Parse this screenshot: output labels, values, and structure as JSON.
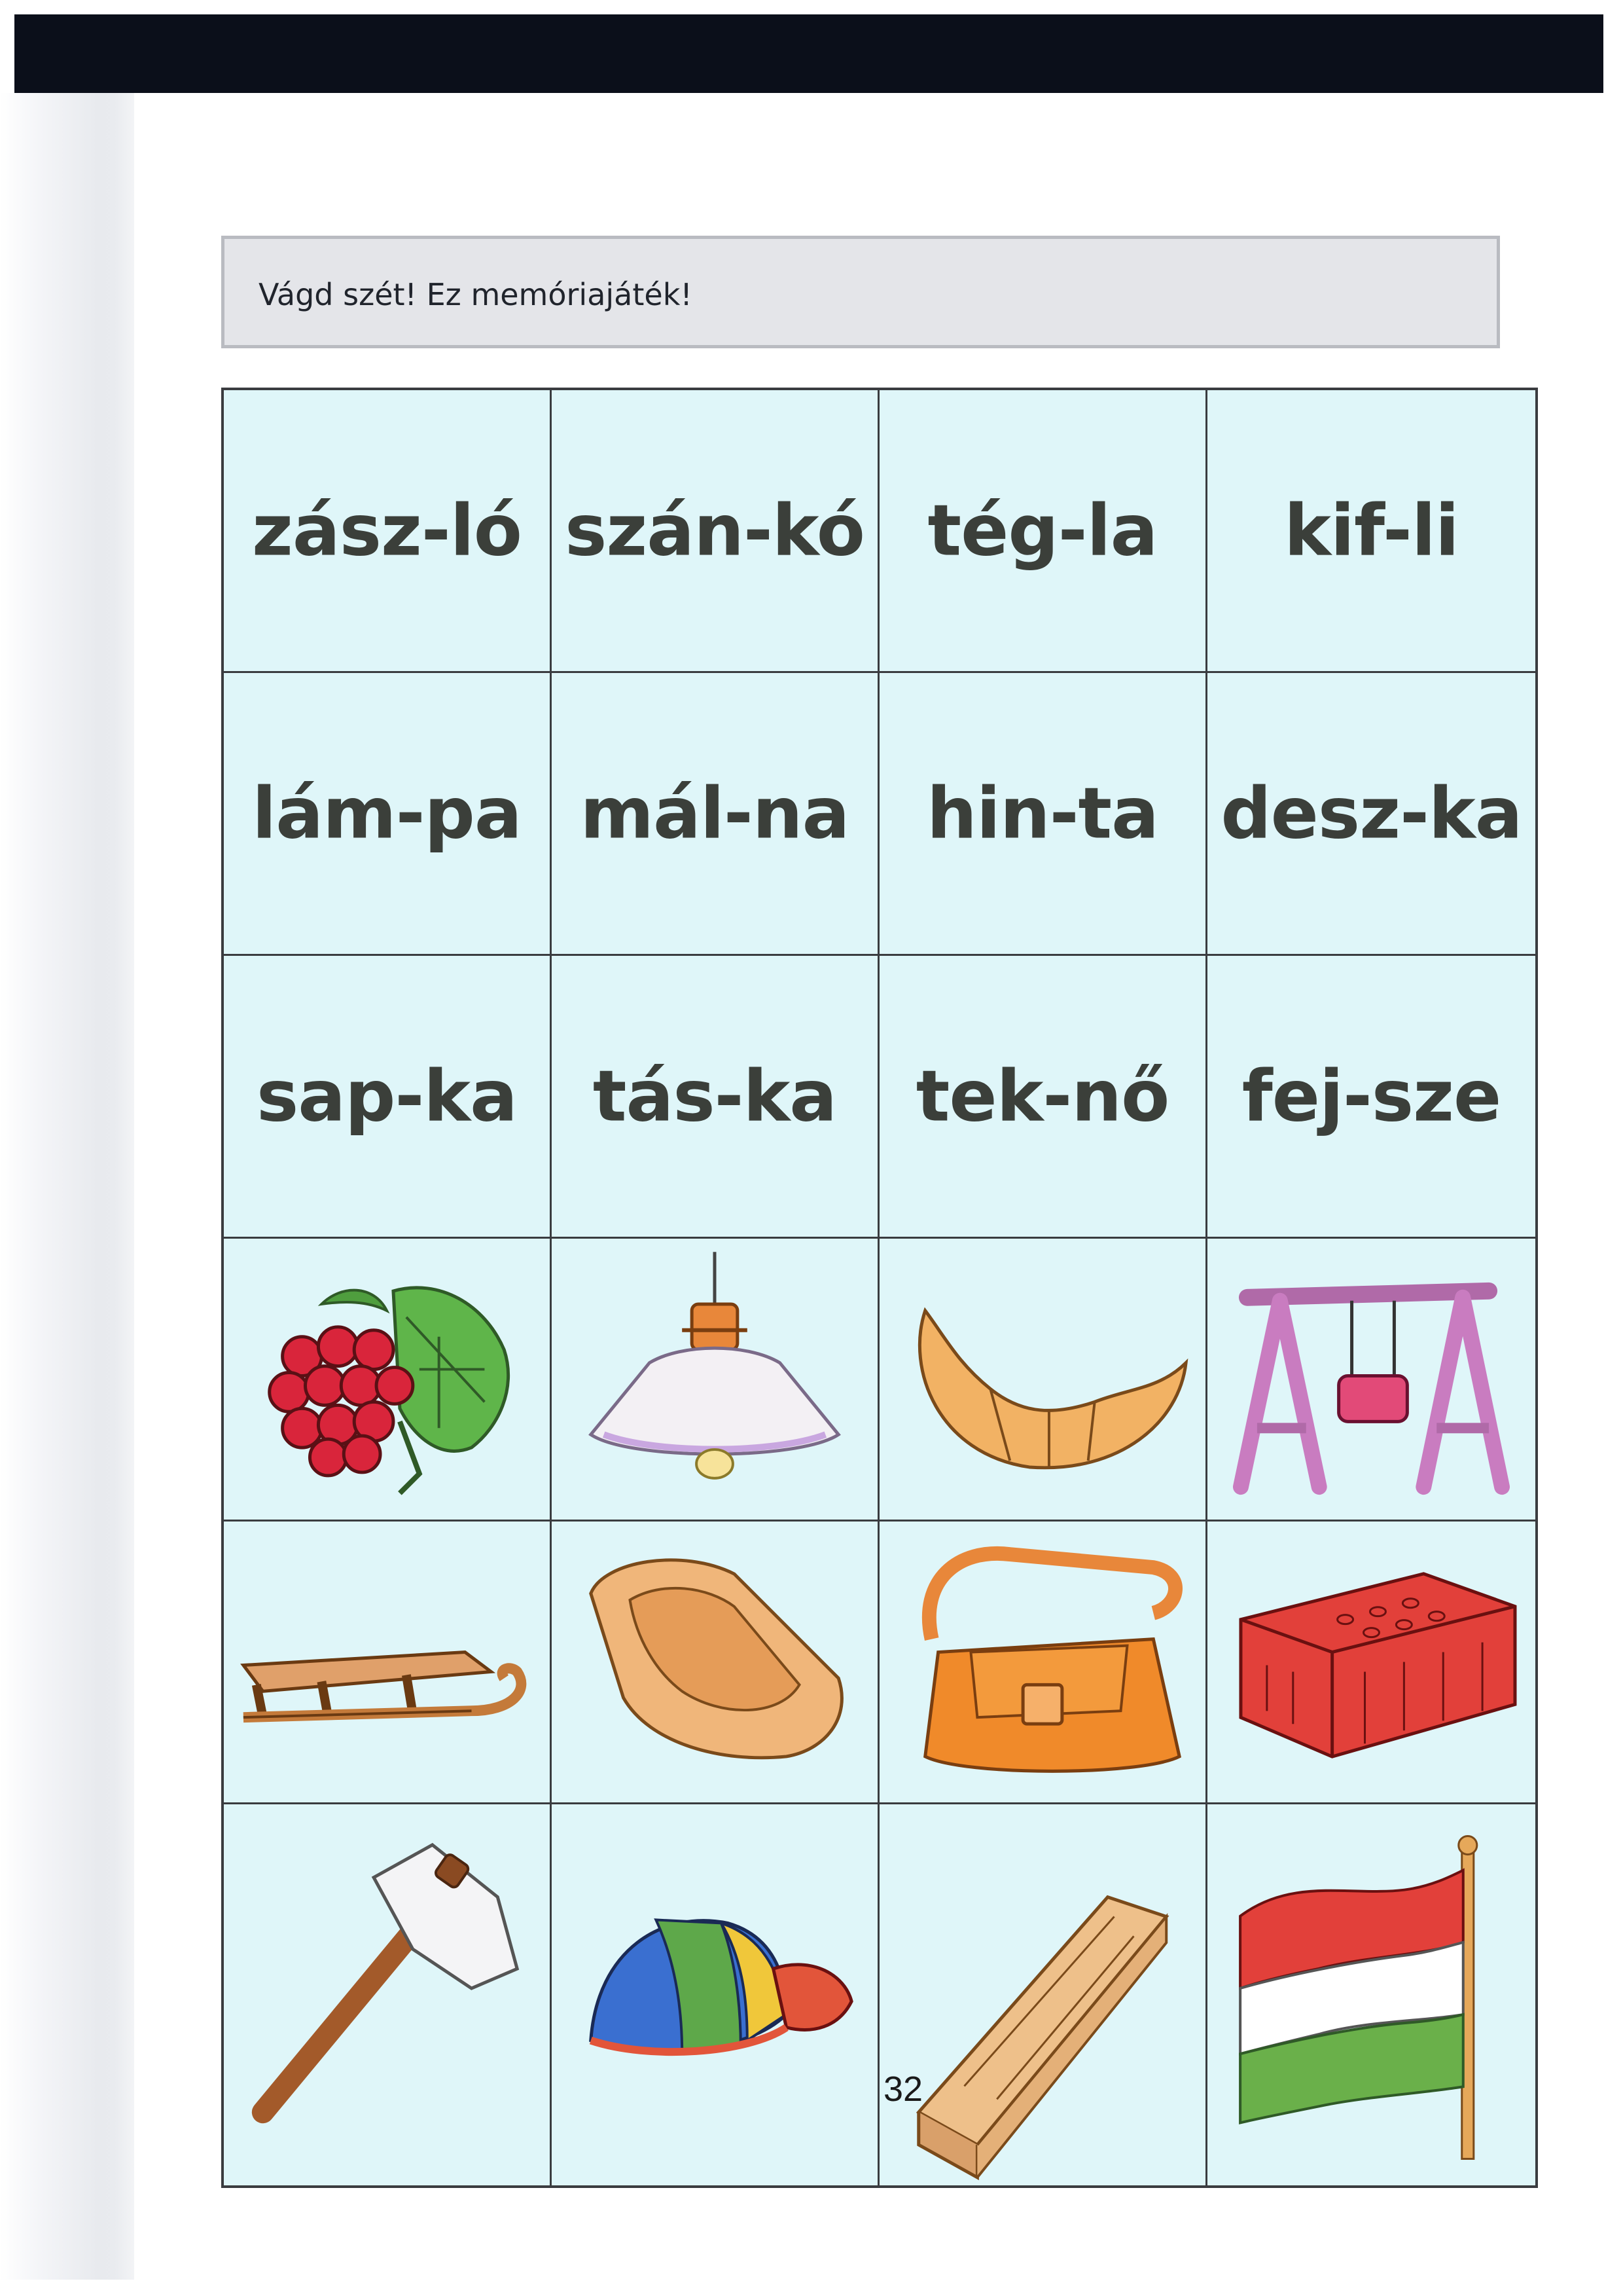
{
  "instruction": "Vágd szét! Ez memóriajáték!",
  "words": [
    "zász-ló",
    "szán-kó",
    "tég-la",
    "kif-li",
    "lám-pa",
    "mál-na",
    "hin-ta",
    "desz-ka",
    "sap-ka",
    "tás-ka",
    "tek-nő",
    "fej-sze"
  ],
  "pictures": [
    "raspberry-icon",
    "lamp-icon",
    "croissant-icon",
    "swing-icon",
    "sled-icon",
    "trough-icon",
    "bag-icon",
    "brick-icon",
    "axe-icon",
    "cap-icon",
    "plank-icon",
    "flag-icon"
  ],
  "colors": {
    "card_background": "#dff6f9",
    "word_text": "#3b3f3a",
    "grid_line": "#3a3c40"
  },
  "page_number": "32"
}
